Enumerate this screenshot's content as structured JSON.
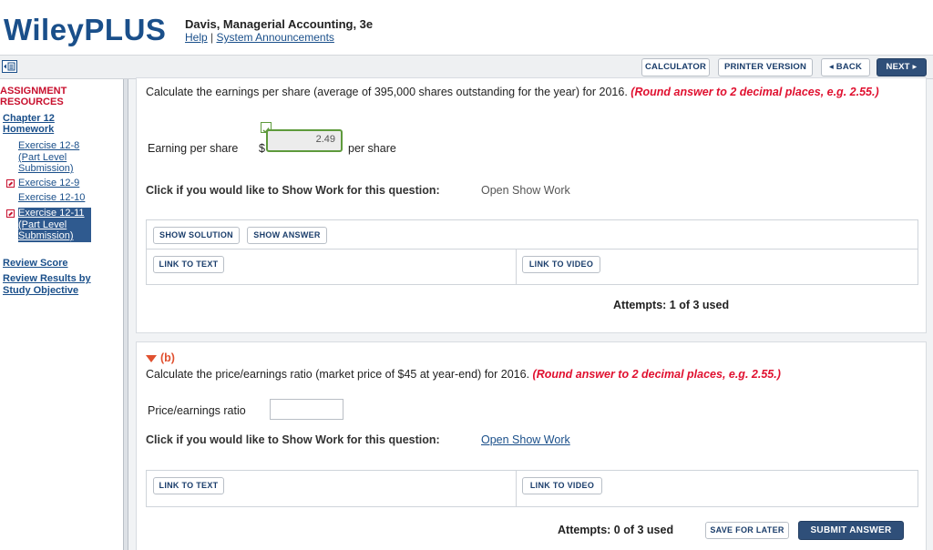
{
  "header": {
    "logo": "WileyPLUS",
    "course_title": "Davis, Managerial Accounting, 3e",
    "help_link": "Help",
    "separator": "|",
    "announcements_link": "System Announcements"
  },
  "toolbar": {
    "calculator": "CALCULATOR",
    "printer_version": "PRINTER VERSION",
    "back": "◂ BACK",
    "next": "NEXT ▸"
  },
  "sidebar": {
    "resources_heading": "ASSIGNMENT RESOURCES",
    "chapter_link": "Chapter 12 Homework",
    "exercises": [
      {
        "label": "Exercise 12-8 (Part Level Submission)",
        "flagged": false,
        "active": false
      },
      {
        "label": "Exercise 12-9",
        "flagged": true,
        "active": false
      },
      {
        "label": "Exercise 12-10",
        "flagged": false,
        "active": false
      },
      {
        "label": "Exercise 12-11 (Part Level Submission)",
        "flagged": true,
        "active": true
      }
    ],
    "review_score": "Review Score",
    "review_results": "Review Results by Study Objective"
  },
  "part_a": {
    "question": "Calculate the earnings per share (average of 395,000 shares outstanding for the year) for 2016.",
    "instruction": "(Round answer to 2 decimal places, e.g. 2.55.)",
    "field_label": "Earning per share",
    "currency": "$",
    "answer_value": "2.49",
    "unit": "per share",
    "show_work_prompt": "Click if you would like to Show Work for this question:",
    "show_work_link": "Open Show Work",
    "show_solution": "SHOW SOLUTION",
    "show_answer": "SHOW ANSWER",
    "link_to_text": "LINK TO TEXT",
    "link_to_video": "LINK TO VIDEO",
    "attempts": "Attempts: 1 of 3 used"
  },
  "part_b": {
    "label": "(b)",
    "question": "Calculate the price/earnings ratio (market price of $45 at year-end) for 2016.",
    "instruction": "(Round answer to 2 decimal places, e.g. 2.55.)",
    "field_label": "Price/earnings ratio",
    "answer_value": "",
    "show_work_prompt": "Click if you would like to Show Work for this question:",
    "show_work_link": "Open Show Work",
    "link_to_text": "LINK TO TEXT",
    "link_to_video": "LINK TO VIDEO",
    "attempts": "Attempts: 0 of 3 used",
    "save_for_later": "SAVE FOR LATER",
    "submit_answer": "SUBMIT ANSWER"
  },
  "colors": {
    "brand_blue": "#1a4f8a",
    "instruction_red": "#e0102f",
    "correct_green": "#5e9a3c",
    "primary_button": "#2f4f79"
  }
}
